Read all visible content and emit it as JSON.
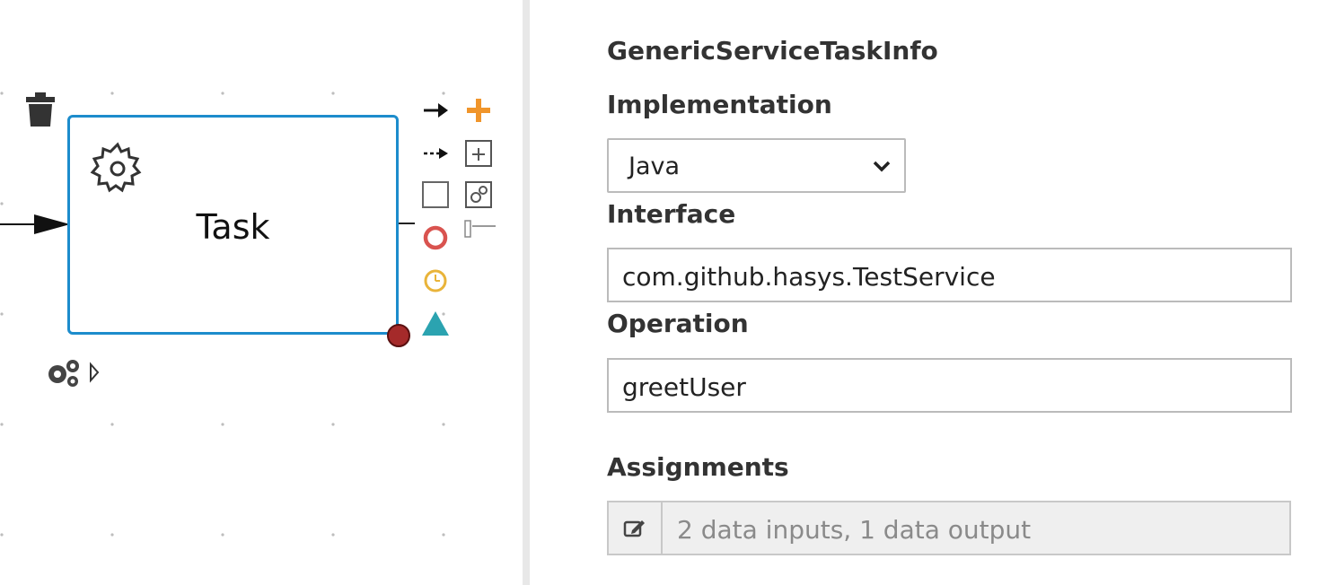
{
  "canvas": {
    "task": {
      "label": "Task"
    },
    "icons": {
      "delete": "trash-icon",
      "task_type": "gear-icon",
      "properties": "gears-icon",
      "expand": "triangle-right-icon"
    },
    "toolbox": [
      "sequence-flow-icon",
      "add-icon",
      "association-icon",
      "subprocess-icon",
      "task-icon",
      "service-task-icon",
      "end-event-icon",
      "timer-event-icon",
      "gateway-icon"
    ],
    "colors": {
      "task_border": "#1c8ccc",
      "add": "#f0952b",
      "end_event": "#d9534f",
      "timer": "#e9b43a",
      "gateway": "#2ba3b0",
      "error_marker": "#a52a2a"
    }
  },
  "panel": {
    "section_title": "GenericServiceTaskInfo",
    "implementation": {
      "label": "Implementation",
      "value": "Java"
    },
    "interface": {
      "label": "Interface",
      "value": "com.github.hasys.TestService"
    },
    "operation": {
      "label": "Operation",
      "value": "greetUser"
    },
    "assignments": {
      "label": "Assignments",
      "value": "2 data inputs, 1 data output",
      "edit_icon": "edit-icon"
    }
  }
}
